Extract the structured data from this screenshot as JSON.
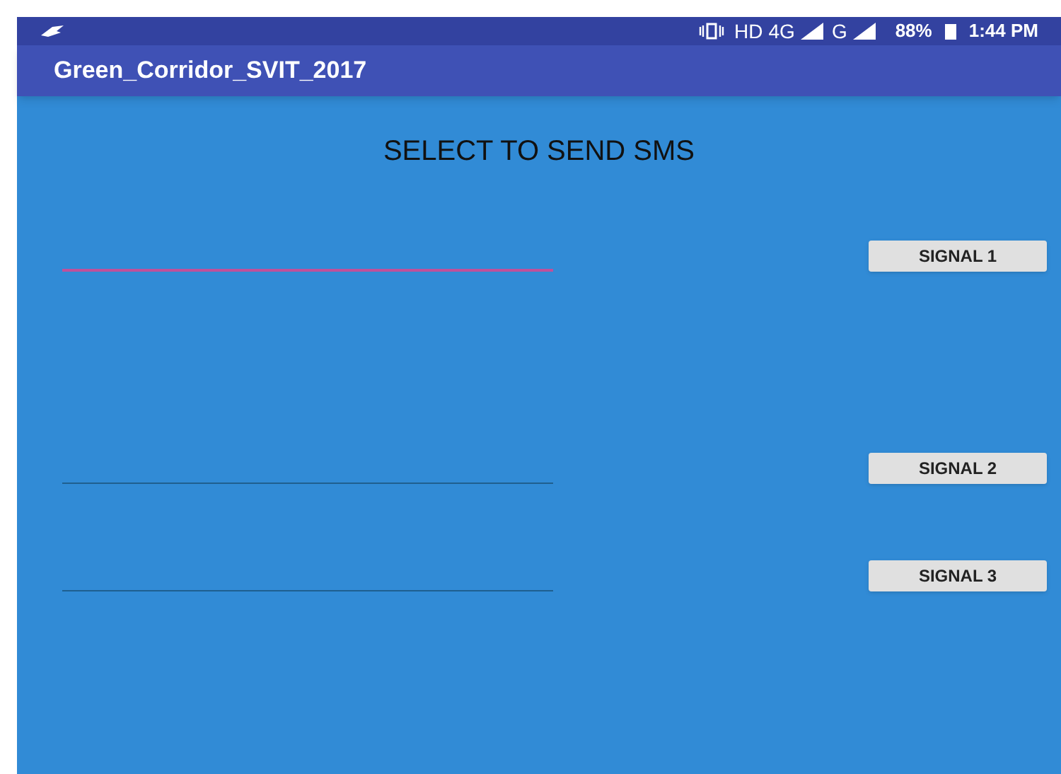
{
  "status_bar": {
    "network_labels": [
      "HD",
      "4G",
      "G"
    ],
    "battery": "88%",
    "time": "1:44 PM"
  },
  "app_bar": {
    "title": "Green_Corridor_SVIT_2017"
  },
  "heading": "SELECT TO SEND SMS",
  "rows": [
    {
      "focused": true,
      "button": "SIGNAL 1"
    },
    {
      "focused": false,
      "button": "SIGNAL 2"
    },
    {
      "focused": false,
      "button": "SIGNAL 3"
    }
  ]
}
